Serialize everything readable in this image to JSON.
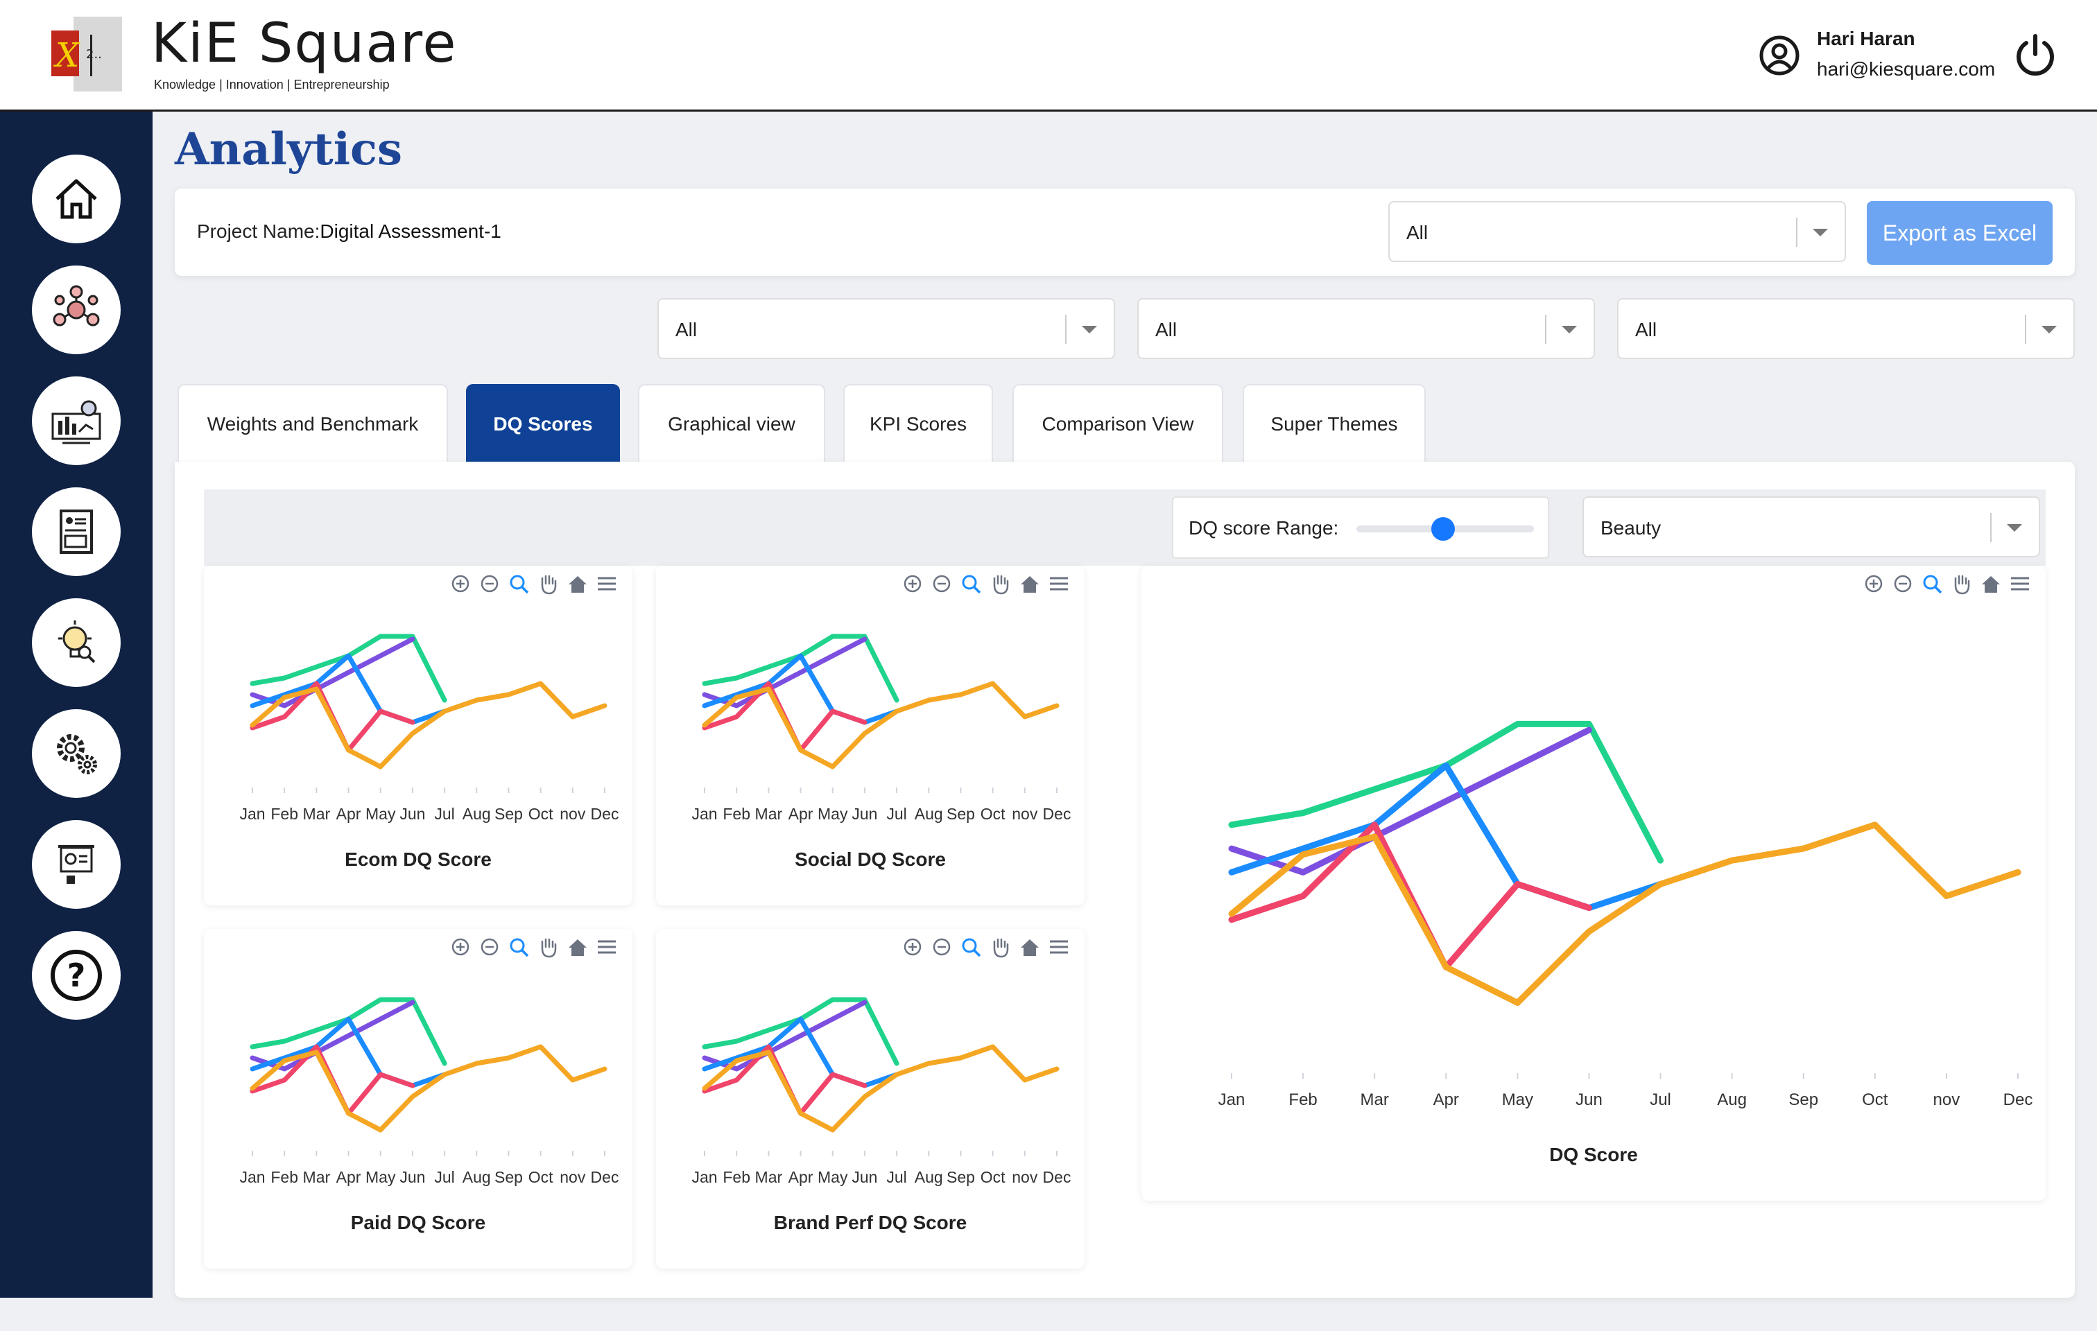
{
  "app": {
    "brand_name": "KiE Square",
    "brand_tagline": "Knowledge | Innovation | Entrepreneurship",
    "logo_text": "2.."
  },
  "user": {
    "name": "Hari Haran",
    "email": "hari@kiesquare.com"
  },
  "sidebar": {
    "items": [
      {
        "icon": "home-icon"
      },
      {
        "icon": "network-brain-icon"
      },
      {
        "icon": "analytics-dashboard-icon"
      },
      {
        "icon": "report-document-icon"
      },
      {
        "icon": "idea-search-icon"
      },
      {
        "icon": "settings-gears-icon"
      },
      {
        "icon": "presentation-icon"
      },
      {
        "icon": "help-icon",
        "glyph": "?"
      }
    ]
  },
  "page": {
    "title": "Analytics",
    "project_label": "Project Name:",
    "project_name": "Digital Assessment-1",
    "project_filter": "All",
    "export_label": "Export as Excel",
    "filters": [
      "All",
      "All",
      "All"
    ]
  },
  "tabs": [
    {
      "label": "Weights and Benchmark",
      "active": false
    },
    {
      "label": "DQ Scores",
      "active": true
    },
    {
      "label": "Graphical view",
      "active": false
    },
    {
      "label": "KPI Scores",
      "active": false
    },
    {
      "label": "Comparison View",
      "active": false
    },
    {
      "label": "Super Themes",
      "active": false
    }
  ],
  "controls": {
    "range_label": "DQ score Range:",
    "range_value": 0.5,
    "category": "Beauty"
  },
  "colors": {
    "sidebar": "#0f2244",
    "accent": "#0f4296",
    "title": "#1e4596",
    "export": "#6ea5f2"
  },
  "chart_data": [
    {
      "type": "line",
      "title": "Ecom DQ Score",
      "categories": [
        "Jan",
        "Feb",
        "Mar",
        "Apr",
        "May",
        "Jun",
        "Jul",
        "Aug",
        "Sep",
        "Oct",
        "nov",
        "Dec"
      ],
      "series": [
        {
          "color": "#1fd38c",
          "values": [
            70,
            72,
            76,
            80,
            87,
            87,
            64,
            null,
            null,
            null,
            null,
            null
          ]
        },
        {
          "color": "#7c4fe0",
          "values": [
            66,
            62,
            68,
            74,
            80,
            86,
            null,
            null,
            null,
            null,
            null,
            null
          ]
        },
        {
          "color": "#1a8cff",
          "values": [
            62,
            66,
            70,
            80,
            60,
            56,
            60,
            null,
            null,
            null,
            null,
            null
          ]
        },
        {
          "color": "#f0446a",
          "values": [
            54,
            58,
            70,
            46,
            60,
            56,
            null,
            null,
            null,
            null,
            null,
            null
          ]
        },
        {
          "color": "#f5a623",
          "values": [
            55,
            65,
            68,
            46,
            40,
            52,
            60,
            64,
            66,
            70,
            58,
            62
          ]
        }
      ]
    },
    {
      "type": "line",
      "title": "Social DQ Score",
      "categories": [
        "Jan",
        "Feb",
        "Mar",
        "Apr",
        "May",
        "Jun",
        "Jul",
        "Aug",
        "Sep",
        "Oct",
        "nov",
        "Dec"
      ],
      "series": [
        {
          "color": "#1fd38c",
          "values": [
            70,
            72,
            76,
            80,
            87,
            87,
            64,
            null,
            null,
            null,
            null,
            null
          ]
        },
        {
          "color": "#7c4fe0",
          "values": [
            66,
            62,
            68,
            74,
            80,
            86,
            null,
            null,
            null,
            null,
            null,
            null
          ]
        },
        {
          "color": "#1a8cff",
          "values": [
            62,
            66,
            70,
            80,
            60,
            56,
            60,
            null,
            null,
            null,
            null,
            null
          ]
        },
        {
          "color": "#f0446a",
          "values": [
            54,
            58,
            70,
            46,
            60,
            56,
            null,
            null,
            null,
            null,
            null,
            null
          ]
        },
        {
          "color": "#f5a623",
          "values": [
            55,
            65,
            68,
            46,
            40,
            52,
            60,
            64,
            66,
            70,
            58,
            62
          ]
        }
      ]
    },
    {
      "type": "line",
      "title": "Paid DQ Score",
      "categories": [
        "Jan",
        "Feb",
        "Mar",
        "Apr",
        "May",
        "Jun",
        "Jul",
        "Aug",
        "Sep",
        "Oct",
        "nov",
        "Dec"
      ],
      "series": [
        {
          "color": "#1fd38c",
          "values": [
            70,
            72,
            76,
            80,
            87,
            87,
            64,
            null,
            null,
            null,
            null,
            null
          ]
        },
        {
          "color": "#7c4fe0",
          "values": [
            66,
            62,
            68,
            74,
            80,
            86,
            null,
            null,
            null,
            null,
            null,
            null
          ]
        },
        {
          "color": "#1a8cff",
          "values": [
            62,
            66,
            70,
            80,
            60,
            56,
            60,
            null,
            null,
            null,
            null,
            null
          ]
        },
        {
          "color": "#f0446a",
          "values": [
            54,
            58,
            70,
            46,
            60,
            56,
            null,
            null,
            null,
            null,
            null,
            null
          ]
        },
        {
          "color": "#f5a623",
          "values": [
            55,
            65,
            68,
            46,
            40,
            52,
            60,
            64,
            66,
            70,
            58,
            62
          ]
        }
      ]
    },
    {
      "type": "line",
      "title": "Brand Perf DQ Score",
      "categories": [
        "Jan",
        "Feb",
        "Mar",
        "Apr",
        "May",
        "Jun",
        "Jul",
        "Aug",
        "Sep",
        "Oct",
        "nov",
        "Dec"
      ],
      "series": [
        {
          "color": "#1fd38c",
          "values": [
            70,
            72,
            76,
            80,
            87,
            87,
            64,
            null,
            null,
            null,
            null,
            null
          ]
        },
        {
          "color": "#7c4fe0",
          "values": [
            66,
            62,
            68,
            74,
            80,
            86,
            null,
            null,
            null,
            null,
            null,
            null
          ]
        },
        {
          "color": "#1a8cff",
          "values": [
            62,
            66,
            70,
            80,
            60,
            56,
            60,
            null,
            null,
            null,
            null,
            null
          ]
        },
        {
          "color": "#f0446a",
          "values": [
            54,
            58,
            70,
            46,
            60,
            56,
            null,
            null,
            null,
            null,
            null,
            null
          ]
        },
        {
          "color": "#f5a623",
          "values": [
            55,
            65,
            68,
            46,
            40,
            52,
            60,
            64,
            66,
            70,
            58,
            62
          ]
        }
      ]
    },
    {
      "type": "line",
      "title": "DQ Score",
      "categories": [
        "Jan",
        "Feb",
        "Mar",
        "Apr",
        "May",
        "Jun",
        "Jul",
        "Aug",
        "Sep",
        "Oct",
        "nov",
        "Dec"
      ],
      "series": [
        {
          "color": "#1fd38c",
          "values": [
            70,
            72,
            76,
            80,
            87,
            87,
            64,
            null,
            null,
            null,
            null,
            null
          ]
        },
        {
          "color": "#7c4fe0",
          "values": [
            66,
            62,
            68,
            74,
            80,
            86,
            null,
            null,
            null,
            null,
            null,
            null
          ]
        },
        {
          "color": "#1a8cff",
          "values": [
            62,
            66,
            70,
            80,
            60,
            56,
            60,
            null,
            null,
            null,
            null,
            null
          ]
        },
        {
          "color": "#f0446a",
          "values": [
            54,
            58,
            70,
            46,
            60,
            56,
            null,
            null,
            null,
            null,
            null,
            null
          ]
        },
        {
          "color": "#f5a623",
          "values": [
            55,
            65,
            68,
            46,
            40,
            52,
            60,
            64,
            66,
            70,
            58,
            62
          ]
        }
      ]
    }
  ]
}
